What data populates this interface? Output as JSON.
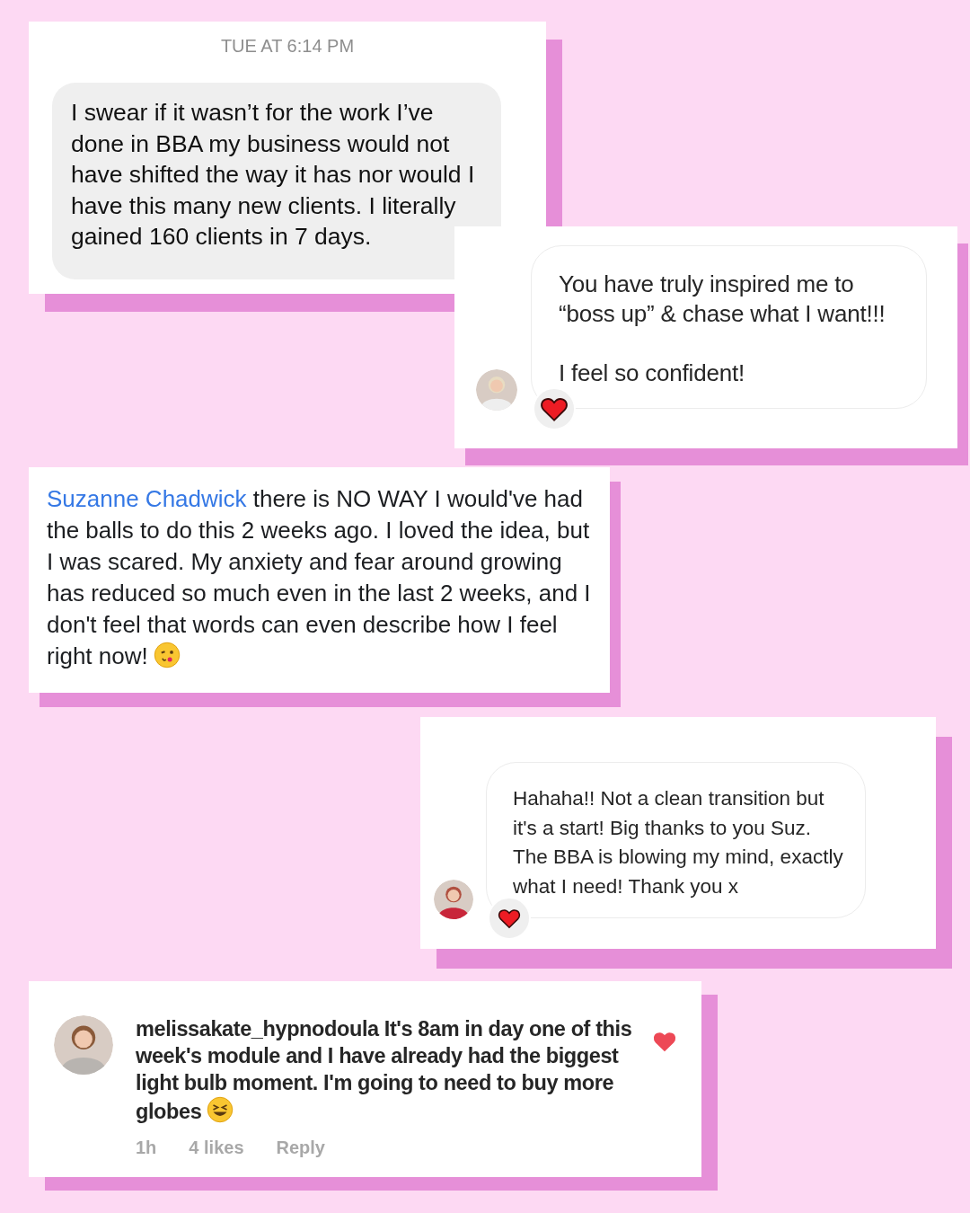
{
  "cards": [
    {
      "kind": "dm_gray",
      "timestamp": "TUE AT 6:14 PM",
      "paragraphs": [
        "I swear if it wasn’t for the work I’ve done in BBA my business would not have shifted the way it has nor would I have this many new clients. I literally gained 160 clients in 7 days."
      ]
    },
    {
      "kind": "dm_outline",
      "paragraphs": [
        "You have truly inspired me to “boss up” & chase what I want!!!",
        "I feel so confident!"
      ],
      "reacted": true
    },
    {
      "kind": "fb_comment",
      "author": "Suzanne Chadwick",
      "text": "there is NO WAY I would've had the balls to do this 2 weeks ago. I loved the idea, but I was scared. My anxiety and fear around growing has reduced so much even in the last 2 weeks, and I don't feel that words can even describe how I feel right now!"
    },
    {
      "kind": "dm_outline",
      "paragraphs": [
        "Hahaha!! Not a clean transition but it's a start! Big thanks to you Suz. The BBA is blowing my mind, exactly what I need! Thank you x"
      ],
      "reacted": true
    },
    {
      "kind": "ig_comment",
      "username": "melissakate_hypnodoula",
      "text": "It's 8am in day one of this week's module and I have already had the biggest light bulb moment. I'm going to need to buy more globes",
      "liked": true,
      "time": "1h",
      "likes": "4 likes",
      "reply": "Reply"
    }
  ]
}
